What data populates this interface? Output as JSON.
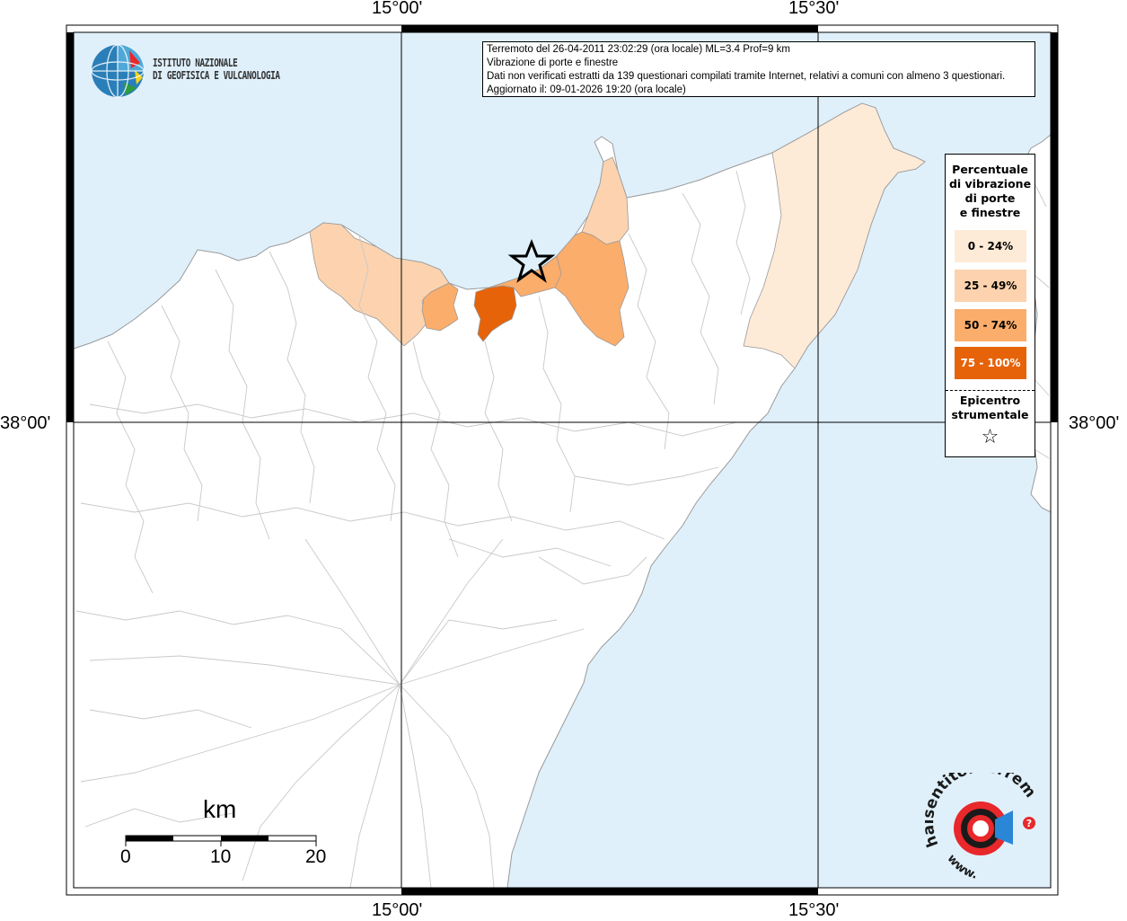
{
  "map": {
    "coordinates": {
      "lon_top_left": "15°00'",
      "lon_top_right": "15°30'",
      "lon_bottom_left": "15°00'",
      "lon_bottom_right": "15°30'",
      "lat_left": "38°00'",
      "lat_right": "38°00'"
    },
    "colors": {
      "sea": "#dff0fb",
      "land": "#ffffff",
      "boundary": "#c8c8c8",
      "class_0_24": "#fdebd7",
      "class_25_49": "#fcd3ae",
      "class_50_74": "#fbad6b",
      "class_75_100": "#e66309"
    }
  },
  "header": {
    "line1": "Terremoto del 26-04-2011 23:02:29 (ora locale) ML=3.4 Prof=9 km",
    "line2": "Vibrazione di porte e finestre",
    "line3": "Dati non verificati estratti da 139 questionari compilati tramite Internet, relativi a comuni con almeno 3 questionari.",
    "line4": "Aggiornato il: 09-01-2026 19:20 (ora locale)"
  },
  "ingv": {
    "line1": "ISTITUTO NAZIONALE",
    "line2": "DI GEOFISICA E VULCANOLOGIA"
  },
  "legend": {
    "title_1": "Percentuale",
    "title_2": "di vibrazione",
    "title_3": "di porte",
    "title_4": "e finestre",
    "items": [
      {
        "label": "0 - 24%",
        "color": "#fdebd7"
      },
      {
        "label": "25 - 49%",
        "color": "#fcd3ae"
      },
      {
        "label": "50 - 74%",
        "color": "#fbad6b"
      },
      {
        "label": "75 - 100%",
        "color": "#e66309"
      }
    ],
    "epicenter_1": "Epicentro",
    "epicenter_2": "strumentale",
    "epicenter_symbol": "☆"
  },
  "scale": {
    "unit": "km",
    "label_0": "0",
    "label_10": "10",
    "label_20": "20"
  },
  "haisentito": {
    "text": "haisentitoilterremoto.it",
    "prefix": "www.",
    "question": "?"
  }
}
